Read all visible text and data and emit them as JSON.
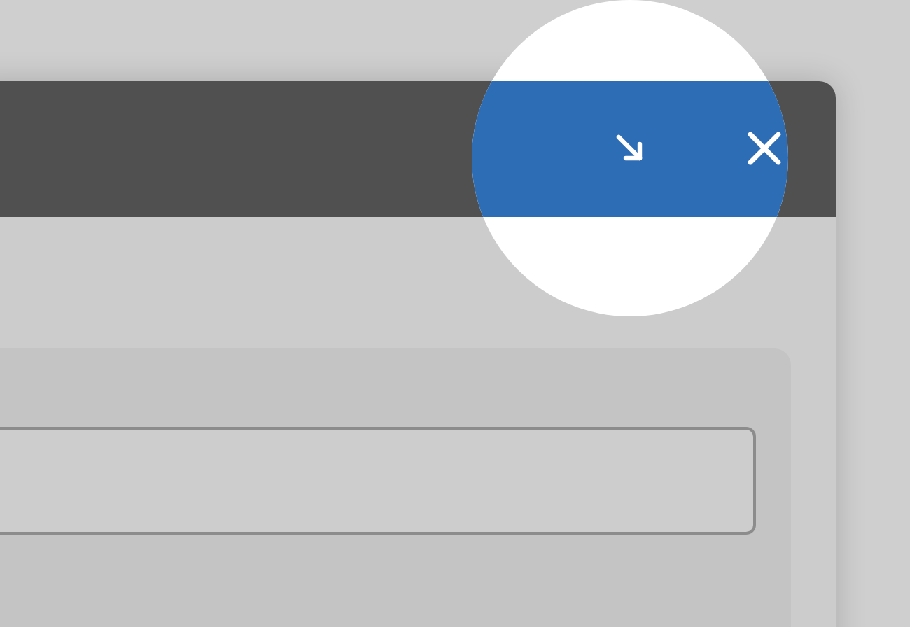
{
  "title_bar": {
    "buttons": [
      {
        "kind": "shrink"
      },
      {
        "kind": "close"
      }
    ],
    "highlighted": true
  },
  "panel": {
    "field": {
      "kind": "text"
    }
  }
}
